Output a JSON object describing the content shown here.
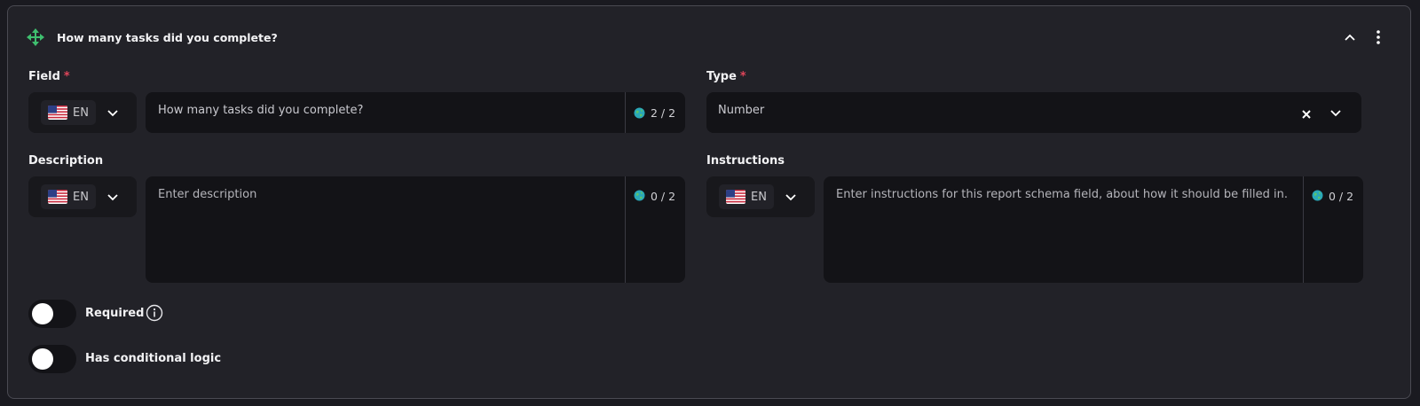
{
  "header": {
    "title": "How many tasks did you complete?",
    "move_icon": "move-arrows-icon",
    "collapse_icon": "chevron-up-icon",
    "menu_icon": "more-vertical-icon",
    "accent_color": "#3fbf6f"
  },
  "field": {
    "label": "Field",
    "required_mark": "*",
    "lang_code": "EN",
    "value": "How many tasks did you complete?",
    "counter": "2 / 2"
  },
  "type": {
    "label": "Type",
    "required_mark": "*",
    "value": "Number"
  },
  "description": {
    "label": "Description",
    "lang_code": "EN",
    "placeholder": "Enter description",
    "counter": "0 / 2"
  },
  "instructions": {
    "label": "Instructions",
    "lang_code": "EN",
    "placeholder": "Enter instructions for this report schema field, about how it should be filled in.",
    "counter": "0 / 2"
  },
  "toggles": {
    "required_label": "Required",
    "required_on": false,
    "conditional_label": "Has conditional logic",
    "conditional_on": false
  }
}
